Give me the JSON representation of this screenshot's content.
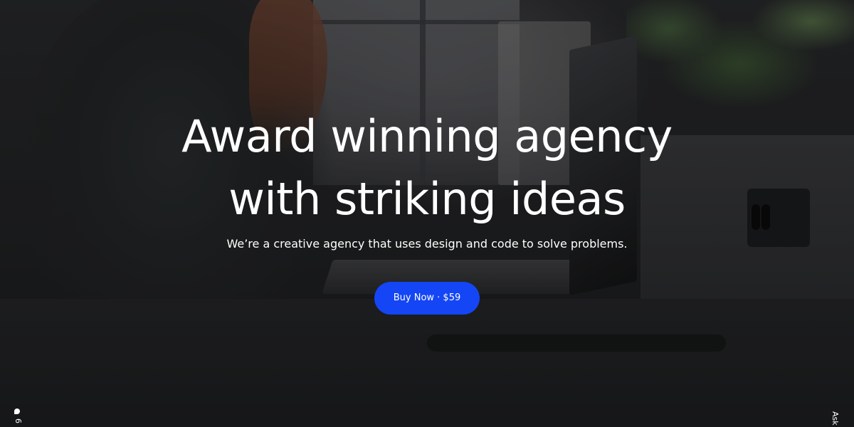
{
  "hero": {
    "headline_line1": "Award winning agency",
    "headline_line2": "with striking ideas",
    "subtitle": "We’re a creative agency that uses design and code to solve problems.",
    "cta_label": "Buy Now · $59",
    "cta_color": "#1446f5"
  },
  "edge_widgets": {
    "left_icon": "chat-bubble-icon",
    "left_text": "6",
    "right_text": "Ask"
  }
}
